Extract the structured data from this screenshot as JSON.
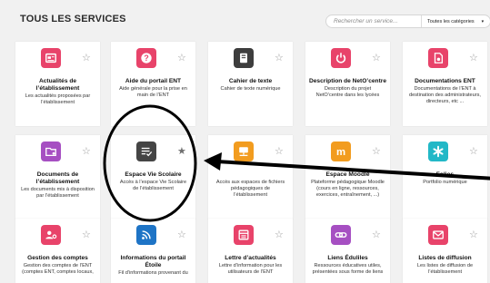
{
  "header": {
    "title": "TOUS LES SERVICES",
    "search_placeholder": "Rechercher un service...",
    "category_selected": "Toutes les catégories",
    "category_arrow": "▾"
  },
  "colors": {
    "background": "#f1f1f1",
    "card": "#ffffff",
    "star": "#9a9a9a",
    "annotation": "#000000"
  },
  "cards": [
    {
      "title": "Actualités de l’établissement",
      "desc": "Les actualités proposées par l’établissement",
      "icon": "news-icon",
      "color": "#e8436a",
      "star": "☆"
    },
    {
      "title": "Aide du portail ENT",
      "desc": "Aide générale pour la prise en main de l’ENT",
      "icon": "help-icon",
      "color": "#e8436a",
      "star": "☆"
    },
    {
      "title": "Cahier de texte",
      "desc": "Cahier de texte numérique",
      "icon": "notebook-icon",
      "color": "#3d3d3d",
      "star": "☆"
    },
    {
      "title": "Description de NetO’centre",
      "desc": "Description du projet NetO’centre dans les lycées",
      "icon": "power-icon",
      "color": "#e8436a",
      "star": "☆"
    },
    {
      "title": "Documentations ENT",
      "desc": "Documentations de l’ENT à destination des administrateurs, directeurs, etc ...",
      "icon": "document-icon",
      "color": "#e8436a",
      "star": "☆"
    },
    {
      "title": "Documents de l’établissement",
      "desc": "Les documents mis à disposition par l’établissement",
      "icon": "folder-icon",
      "color": "#a64fc2",
      "star": "☆"
    },
    {
      "title": "Espace Vie Scolaire",
      "desc": "Accès à l’espace Vie Scolaire de l’établissement",
      "icon": "checklist-icon",
      "color": "#454545",
      "star": "★"
    },
    {
      "title": "",
      "desc": "Accès aux espaces de fichiers pédagogiques de l’établissement",
      "icon": "network-icon",
      "color": "#f29c1f",
      "star": "☆"
    },
    {
      "title": "Espace Moodle",
      "desc": "Plateforme pédagogique Moodle (cours en ligne, ressources, exercices, entraînement, ...)",
      "icon": "moodle-icon",
      "color": "#f29c1f",
      "star": "☆"
    },
    {
      "title": "Folios",
      "desc": "Portfolio numérique",
      "icon": "asterisk-icon",
      "color": "#22b8c7",
      "star": "☆"
    },
    {
      "title": "Gestion des comptes",
      "desc": "Gestion des comptes de l’ENT (comptes ENT, comptes locaux,",
      "icon": "users-settings-icon",
      "color": "#e8436a",
      "star": "☆"
    },
    {
      "title": "Informations du portail Étoile",
      "desc": "Fil d’informations provenant du",
      "icon": "rss-icon",
      "color": "#1e74c6",
      "star": "☆"
    },
    {
      "title": "Lettre d’actualités",
      "desc": "Lettre d’information pour les utilisateurs de l’ENT",
      "icon": "newsletter-icon",
      "color": "#e8436a",
      "star": "☆"
    },
    {
      "title": "Liens Éduliles",
      "desc": "Ressources éducatives utiles, présentées sous forme de liens",
      "icon": "link-icon",
      "color": "#a64fc2",
      "star": "☆"
    },
    {
      "title": "Listes de diffusion",
      "desc": "Les listes de diffusion de l’établissement",
      "icon": "mail-icon",
      "color": "#e8436a",
      "star": "☆"
    }
  ]
}
